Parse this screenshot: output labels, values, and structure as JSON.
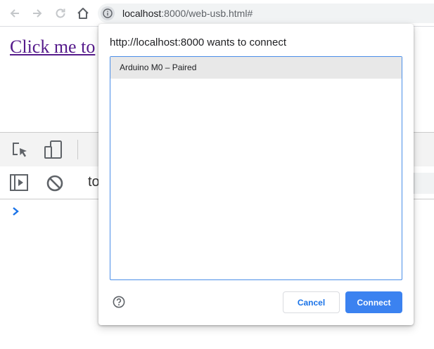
{
  "browser": {
    "nav": {
      "back_icon": "arrow-left-icon",
      "forward_icon": "arrow-right-icon",
      "reload_icon": "reload-icon",
      "home_icon": "home-icon"
    },
    "omnibox": {
      "info_icon": "info-icon",
      "url_host": "localhost",
      "url_rest": ":8000/web-usb.html#"
    }
  },
  "page": {
    "link_text": "Click me to"
  },
  "devtools": {
    "toolbar_icons": [
      "inspect-element-icon",
      "device-toolbar-icon"
    ],
    "console_icons": [
      "sidebar-toggle-icon",
      "clear-console-icon"
    ],
    "context_text": "to",
    "prompt_icon": "chevron-right-icon"
  },
  "dialog": {
    "title": "http://localhost:8000 wants to connect",
    "devices": [
      {
        "label": "Arduino M0 – Paired",
        "selected": true
      }
    ],
    "help_icon": "help-icon",
    "cancel_label": "Cancel",
    "connect_label": "Connect"
  },
  "colors": {
    "accent": "#3b82f0",
    "link_visited": "#551a8b",
    "list_border": "#4a8ee8",
    "selected_row": "#e8e8e8"
  }
}
